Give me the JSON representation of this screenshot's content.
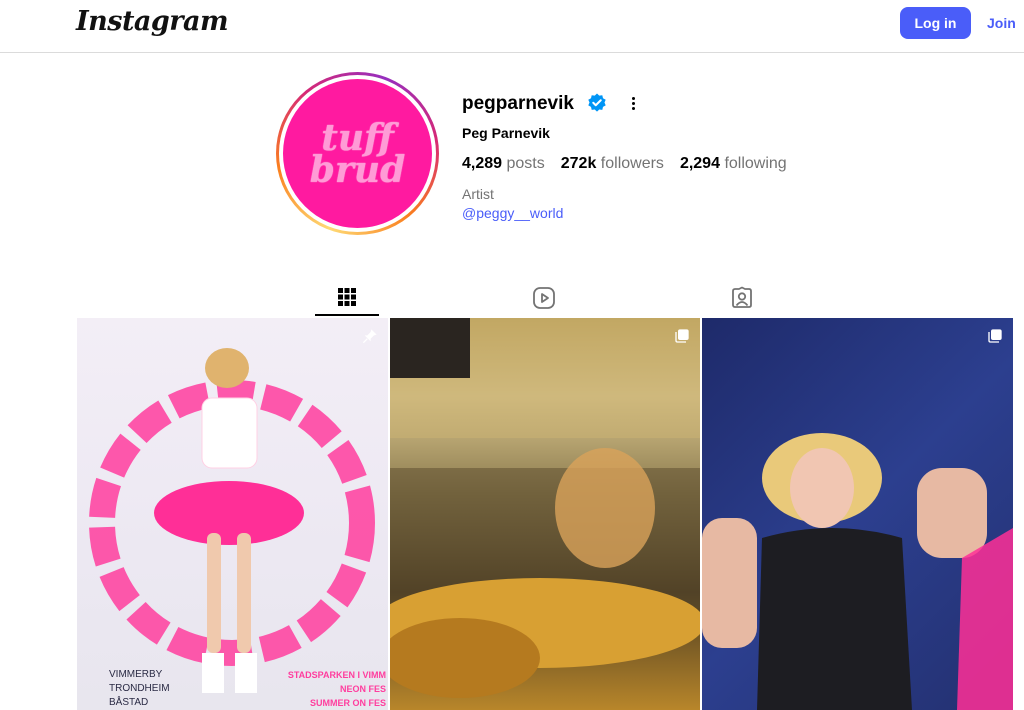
{
  "header": {
    "logo": "Instagram",
    "login_label": "Log in",
    "join_label": "Join"
  },
  "profile": {
    "avatar_text_line1": "tuff",
    "avatar_text_line2": "brud",
    "username": "pegparnevik",
    "verified": true,
    "full_name": "Peg Parnevik",
    "stats": {
      "posts_value": "4,289",
      "posts_label": "posts",
      "followers_value": "272k",
      "followers_label": "followers",
      "following_value": "2,294",
      "following_label": "following"
    },
    "category": "Artist",
    "bio_link": "@peggy__world"
  },
  "tabs": [
    {
      "name": "posts",
      "icon": "grid-icon",
      "active": true
    },
    {
      "name": "reels",
      "icon": "reels-icon",
      "active": false
    },
    {
      "name": "tagged",
      "icon": "tagged-icon",
      "active": false
    }
  ],
  "posts": [
    {
      "type": "pinned",
      "icon": "pin-icon",
      "poster_lines_left": [
        "VIMMERBY",
        "TRONDHEIM",
        "BÅSTAD"
      ],
      "poster_lines_right": [
        "STADSPARKEN I VIMM",
        "NEON FES",
        "SUMMER ON FES"
      ]
    },
    {
      "type": "carousel",
      "icon": "carousel-icon"
    },
    {
      "type": "carousel",
      "icon": "carousel-icon"
    }
  ],
  "colors": {
    "accent": "#4a5df9",
    "avatar_bg": "#ff1aa0",
    "verified": "#0095f6"
  }
}
